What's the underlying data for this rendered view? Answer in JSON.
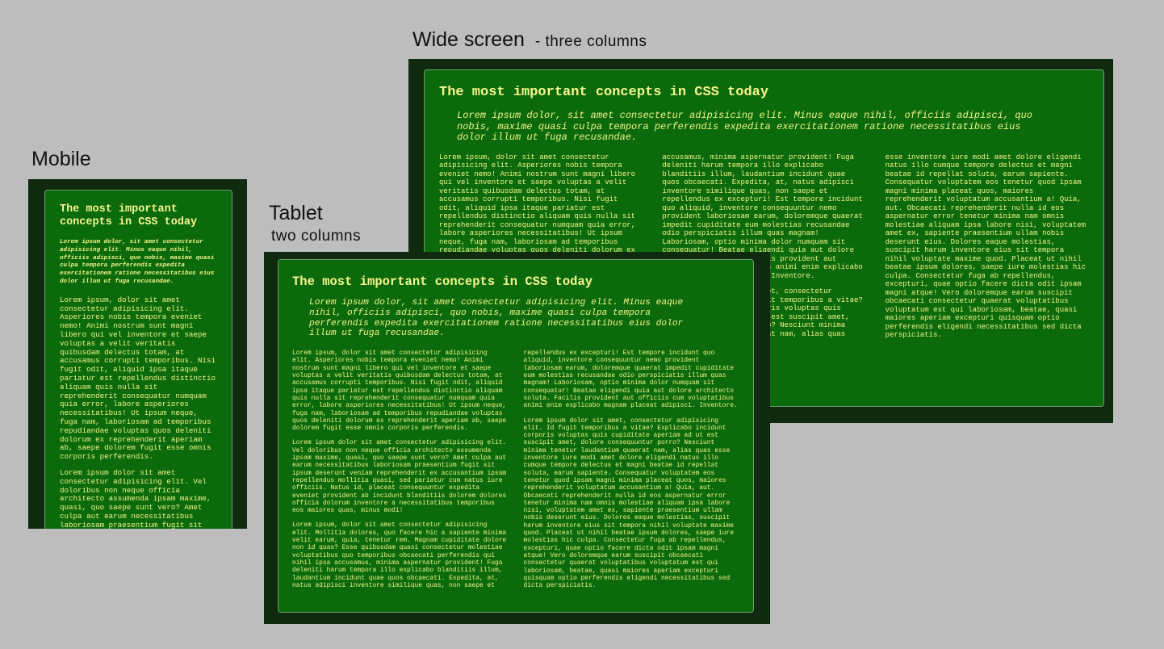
{
  "captions": {
    "wide_title": "Wide screen",
    "wide_sub": "- three columns",
    "mobile_title": "Mobile",
    "tablet_title": "Tablet",
    "tablet_sub": "two columns"
  },
  "article": {
    "title": "The most important concepts in CSS today",
    "lead": "Lorem ipsum dolor, sit amet consectetur adipisicing elit. Minus eaque nihil, officiis adipisci, quo nobis, maxime quasi culpa tempora perferendis expedita exercitationem ratione necessitatibus eius dolor illum ut fuga recusandae.",
    "p1": "Lorem ipsum, dolor sit amet consectetur adipisicing elit. Asperiores nobis tempora eveniet nemo! Animi nostrum sunt magni libero qui vel inventore et saepe voluptas a velit veritatis quibusdam delectus totam, at accusamus corrupti temporibus. Nisi fugit odit, aliquid ipsa itaque pariatur est repellendus distinctio aliquam quis nulla sit reprehenderit consequatur numquam quia error, labore asperiores necessitatibus! Ut ipsum neque, fuga nam, laboriosam ad temporibus repudiandae voluptas quos deleniti dolorum ex reprehenderit aperiam ab, saepe dolorem fugit esse omnis corporis perferendis.",
    "p2": "Lorem ipsum dolor sit amet consectetur adipisicing elit. Vel doloribus non neque officia architecto assumenda ipsam maxime, quasi, quo saepe sunt vero? Amet culpa aut earum necessitatibus laboriosam praesentium fugit sit ipsum deserunt veniam reprehenderit ex accusantium ipsam repellendus mollitia quasi, sed pariatur cum natus iure officiis. Natus id, placeat consequuntur expedita eveniet provident ab incidunt blanditiis dolorem dolores officia dolorum inventore a necessitatibus temporibus eos maiores quas, minus modi!",
    "p3": "Lorem ipsum, dolor sit amet consectetur adipisicing elit. Mollitia dolores, quo facere hic a sapiente minima velit earum, quia, tenetur rem. Magnam cupiditate dolore non id quas? Esse quibusdam quasi consectetur molestiae voluptatibus quo temporibus obcaecati perferendis qui nihil ipsa accusamus, minima aspernatur provident! Fuga deleniti harum tempora illo explicabo blanditiis illum, laudantium incidunt quae quos obcaecati. Expedita, at, natus adipisci inventore similique quas, non saepe et repellendus ex excepturi! Est tempore incidunt quo aliquid, inventore consequuntur nemo provident laboriosam earum, doloremque quaerat impedit cupiditate eum molestias recusandae odio perspiciatis illum quas magnam! Laboriosam, optio minima dolor numquam sit consequatur! Beatae eligendi quia aut dolore architecto soluta. Facilis provident aut officiis cum voluptatibus animi enim explicabo magnam placeat adipisci. Inventore.",
    "p4": "Lorem ipsum dolor sit amet, consectetur adipisicing elit. Id fugit temporibus a vitae? Explicabo incidunt corporis voluptas quis cupiditate aperiam ad ut est suscipit amet, dolore consequuntur porro? Nesciunt minima tenetur laudantium quaerat nam, alias quas esse inventore iure modi amet dolore eligendi natus illo cumque tempore delectus et magni beatae id repellat soluta, earum sapiente. Consequatur voluptatem eos tenetur quod ipsam magni minima placeat quos, maiores reprehenderit voluptatum accusantium a! Quia, aut. Obcaecati reprehenderit nulla id eos aspernatur error tenetur minima nam omnis molestiae aliquam ipsa labore nisi, voluptatem amet ex, sapiente praesentium ullam nobis deserunt eius. Dolores eaque molestias, suscipit harum inventore eius sit tempora nihil voluptate maxime quod. Placeat ut nihil beatae ipsum dolores, saepe iure molestias hic culpa. Consectetur fuga ab repellendus, excepturi, quae optio facere dicta odit ipsam magni atque! Vero doloremque earum suscipit obcaecati consectetur quaerat voluptatibus voluptatum est qui laboriosam, beatae, quasi maiores aperiam excepturi quisquam optio perferendis eligendi necessitatibus sed dicta perspiciatis."
  }
}
